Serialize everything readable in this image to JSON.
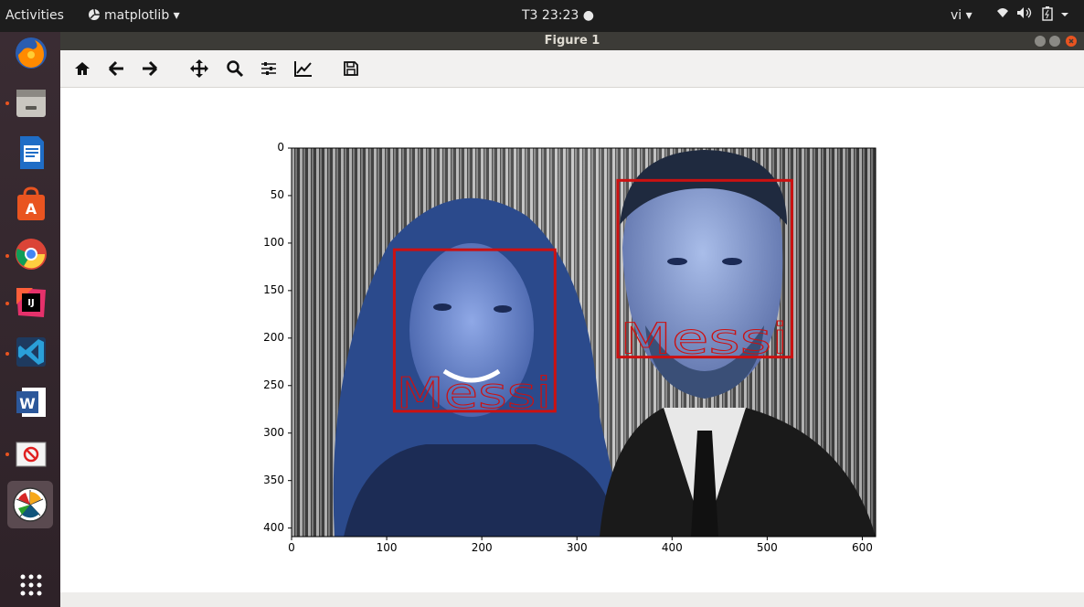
{
  "topbar": {
    "activities": "Activities",
    "app_menu": "matplotlib ▾",
    "clock": "T3 23:23 ●",
    "keyboard": "vi ▾"
  },
  "window": {
    "title": "Figure 1"
  },
  "dock": {
    "items": [
      "firefox-icon",
      "files-icon",
      "writer-icon",
      "software-icon",
      "chrome-icon",
      "intellij-icon",
      "vscode-icon",
      "word-icon",
      "blocked-app-icon",
      "matplotlib-app-icon",
      "show-apps-icon"
    ]
  },
  "toolbar": {
    "buttons": [
      "home",
      "back",
      "forward",
      "pan",
      "zoom",
      "configure-subplots",
      "edit-axes",
      "save"
    ]
  },
  "figure": {
    "xticks": [
      "0",
      "100",
      "200",
      "300",
      "400",
      "500",
      "600"
    ],
    "yticks": [
      "0",
      "50",
      "100",
      "150",
      "200",
      "250",
      "300",
      "350",
      "400"
    ],
    "face_boxes": [
      {
        "label": "Messi",
        "x0": 108,
        "y0": 107,
        "x1": 277,
        "y1": 277,
        "color": "#cc1111"
      },
      {
        "label": "Messi",
        "x0": 343,
        "y0": 34,
        "x1": 526,
        "y1": 220,
        "color": "#cc1111"
      }
    ],
    "image_width": 614,
    "image_height": 409,
    "xlim": [
      0,
      614
    ],
    "ylim": [
      409,
      0
    ]
  }
}
